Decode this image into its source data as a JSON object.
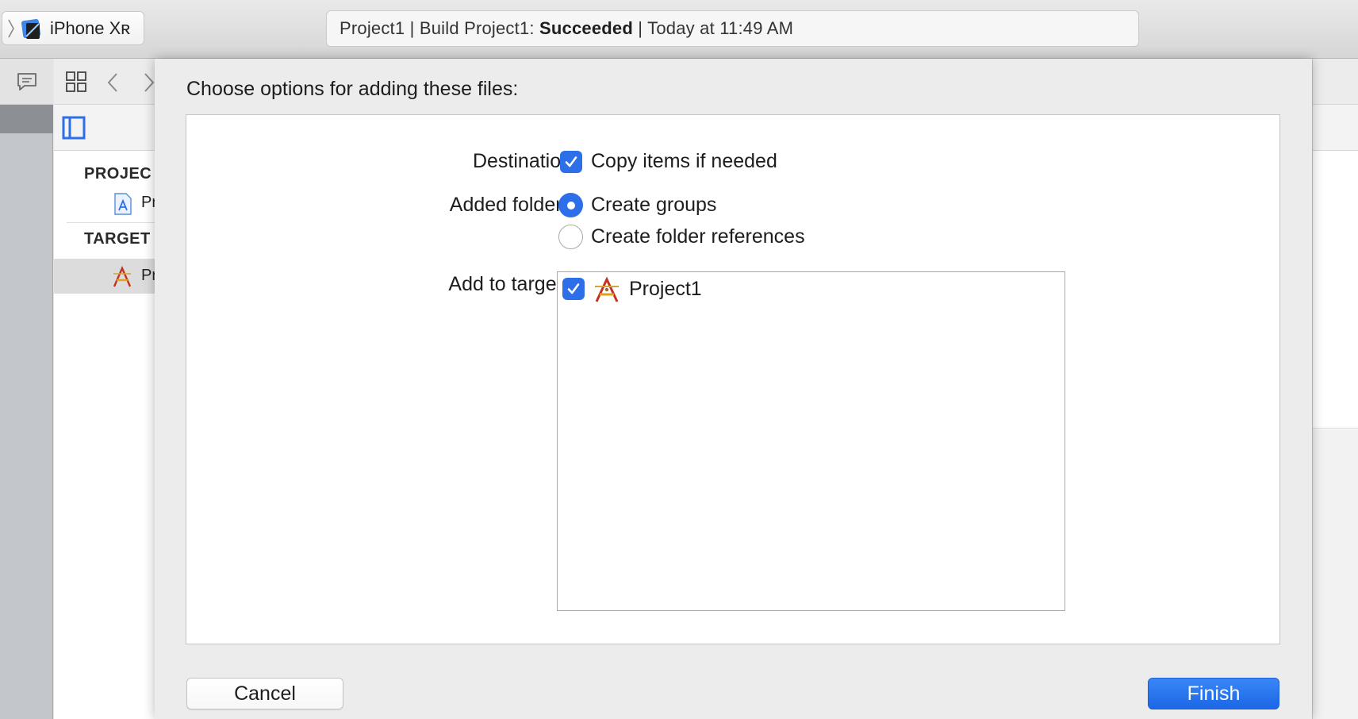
{
  "toolbar": {
    "scheme_device": "iPhone Xʀ",
    "activity": {
      "prefix": "Project1 | Build Project1: ",
      "status": "Succeeded",
      "suffix": " | Today at 11:49 AM"
    }
  },
  "navigator": {
    "project_section": "PROJEC",
    "project_item": "Pr",
    "targets_section": "TARGET",
    "target_item": "Pr"
  },
  "sheet": {
    "title": "Choose options for adding these files:",
    "destination": {
      "label": "Destination:",
      "option": "Copy items if needed",
      "checked": true
    },
    "added_folders": {
      "label": "Added folders:",
      "options": [
        "Create groups",
        "Create folder references"
      ],
      "selected": "Create groups"
    },
    "add_to_targets": {
      "label": "Add to targets:",
      "targets": [
        {
          "name": "Project1",
          "checked": true
        }
      ]
    },
    "buttons": {
      "cancel": "Cancel",
      "finish": "Finish"
    }
  },
  "colors": {
    "accent": "#2d6fe8",
    "finish_button": "#2470ee",
    "sheet_background": "#ececec"
  }
}
